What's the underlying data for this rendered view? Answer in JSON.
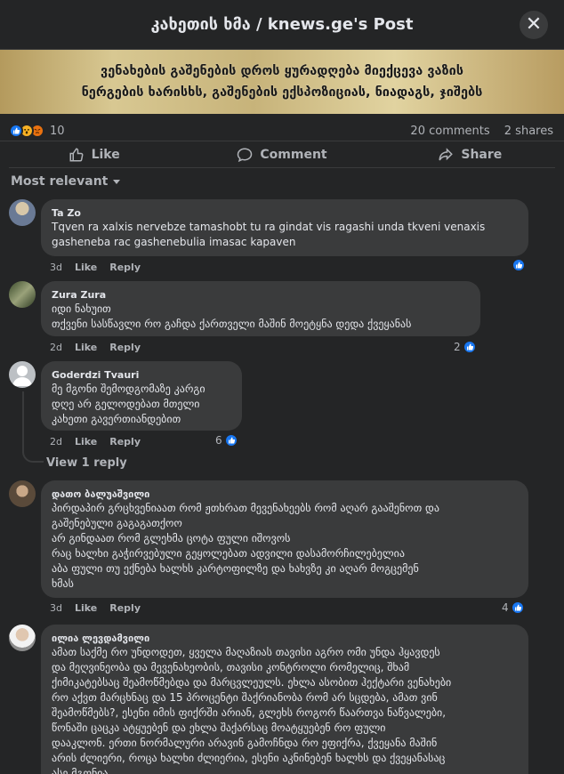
{
  "header": {
    "title": "კახეთის ხმა / knews.ge's Post",
    "close_symbol": "✕"
  },
  "banner": {
    "line1": "ვენახების გაშენების დროს ყურადღება მიექცევა ვაზის",
    "line2": "ნერგების ხარისხს, გაშენების ექსპოზიციას, ნიადაგს, ჯიშებს"
  },
  "stats": {
    "reaction_count": "10",
    "comments": "20 comments",
    "shares": "2 shares"
  },
  "actions": {
    "like": "Like",
    "comment": "Comment",
    "share": "Share"
  },
  "sort": {
    "label": "Most relevant"
  },
  "comments": [
    {
      "author": "Ta Zo",
      "lines": [
        "Tqven ra xalxis nervebze tamashobt tu ra gindat vis ragashi unda tkveni venaxis",
        "gasheneba rac gashenebulia imasac kapaven"
      ],
      "time": "3d",
      "like": "Like",
      "reply": "Reply",
      "reactions": ""
    },
    {
      "author": "Zura Zura",
      "lines": [
        "იდი ნახუით",
        "თქვენი სასწავლი რო გაჩდა ქართველი მაშინ მოეტყნა დედა ქვეყანას"
      ],
      "time": "2d",
      "like": "Like",
      "reply": "Reply",
      "reactions": "2"
    },
    {
      "author": "Goderdzi Tvauri",
      "lines": [
        "მე მგონი შემოდგომაზე კარგი",
        "დღე არ გელოდებათ მთელი",
        "კახეთი გავერთიანდებით"
      ],
      "time": "2d",
      "like": "Like",
      "reply": "Reply",
      "reactions": "6"
    },
    {
      "author": "დათო ბალუაშვილი",
      "lines": [
        "პირდაპირ გრცხვენიაათ რომ ჟთხრათ მევენახეებს რომ აღარ გააშენოთ და",
        "გაშენებული გაგაგათქოო",
        "არ გინდაათ რომ გლეხმა ცოტა ფული იშოვოს",
        "რაც ხალხი გაჭირვებული გეყოლებათ ადვილი დასამორჩილებელია",
        "აბა ფული თუ ექნება ხალხს კარტოფილზე და ხახვზე კი აღარ მოგცემენ",
        "ხმას"
      ],
      "time": "3d",
      "like": "Like",
      "reply": "Reply",
      "reactions": "4"
    },
    {
      "author": "ილია ლევდამვილი",
      "lines": [
        "ამათ საქმე რო უნდოდეთ, ყველა მაღაზიას თავისი აგრო ომი უნდა ჰყავდეს",
        "და მეღვინეობა და მევენახეობის, თავისი კონტროლი რომელიც, შხამ",
        "ქიმიკატებსაც შეამოწმებდა და მარცვლეულს. ეხლა ასობით ჰექტარი ვენახები",
        "რო აქვთ მარცხნაც და 15 პროცენტი შაქრიანობა რომ არ სცდება, ამათ ვინ",
        "შეამოწმებს?, ესენი იმის ფიქრში არიან, გლეხს როგორ წაართვა ნაწვალები,",
        "წონაში ცაცკა ატყუებენ და ეხლა შაქარსაც მოატყუებენ რო ფული",
        "დააკლონ. ერთი ნორმალური არავინ გამოჩნდა რო ეფიქრა, ქვეყანა მაშინ",
        "არის ძლიერი, როცა ხალხი ძლიერია, ესენი აკნინებენ ხალხს და ქვეყანასაც",
        "ასე მგონია"
      ],
      "time": "",
      "like": "",
      "reply": "",
      "reactions": ""
    }
  ],
  "view_replies": "View 1 reply"
}
